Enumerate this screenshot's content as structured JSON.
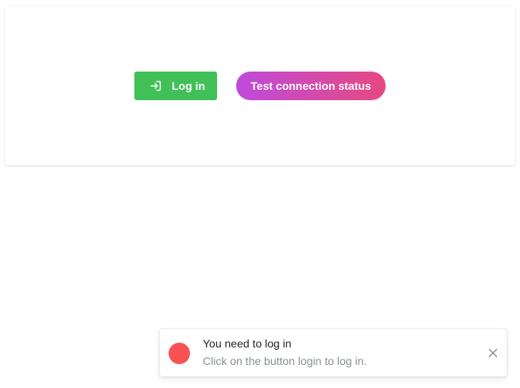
{
  "actions": {
    "login_label": "Log in",
    "test_connection_label": "Test connection status"
  },
  "notification": {
    "title": "You need to log in",
    "message": "Click on the button login to log in.",
    "status_color": "#fa5252",
    "close_icon": "close-icon"
  },
  "colors": {
    "login_button": "#40c057",
    "test_button_gradient_start": "#be4bdb",
    "test_button_gradient_end": "#e64980"
  },
  "icons": {
    "login": "login-icon",
    "close": "close-icon"
  }
}
